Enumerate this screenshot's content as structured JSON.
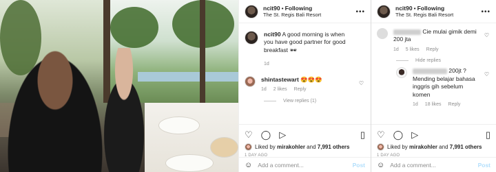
{
  "post": {
    "username": "ncit90",
    "separator": "•",
    "follow_label": "Following",
    "location": "The St. Regis Bali Resort",
    "more_label": "•••"
  },
  "panel_a": {
    "caption": {
      "username": "ncit90",
      "text": "A good morning is when you have good partner for good breakfast 🕶",
      "time": "1d"
    },
    "comments": [
      {
        "username": "shintastewart",
        "text": "😍😍😍",
        "time": "1d",
        "likes": "2 likes",
        "reply_label": "Reply"
      }
    ],
    "view_replies_label": "View replies (1)"
  },
  "panel_b": {
    "comments": [
      {
        "text": "Cie mulai gimik demi 200 jta",
        "time": "1d",
        "likes": "5 likes",
        "reply_label": "Reply"
      }
    ],
    "hide_replies_label": "Hide replies",
    "reply": {
      "text": "200jt ? Mending belajar bahasa inggris gih sebelum komen",
      "time": "1d",
      "likes": "18 likes",
      "reply_label": "Reply"
    }
  },
  "footer": {
    "liked_by_prefix": "Liked by",
    "liked_by_user": "mirakohler",
    "and_label": "and",
    "others_count": "7,991 others",
    "date": "1 DAY AGO",
    "add_comment_placeholder": "Add a comment...",
    "post_label": "Post"
  },
  "icons": {
    "heart": "♡",
    "comment": "◯",
    "share": "▷",
    "save": "▯",
    "emoji": "☺"
  }
}
